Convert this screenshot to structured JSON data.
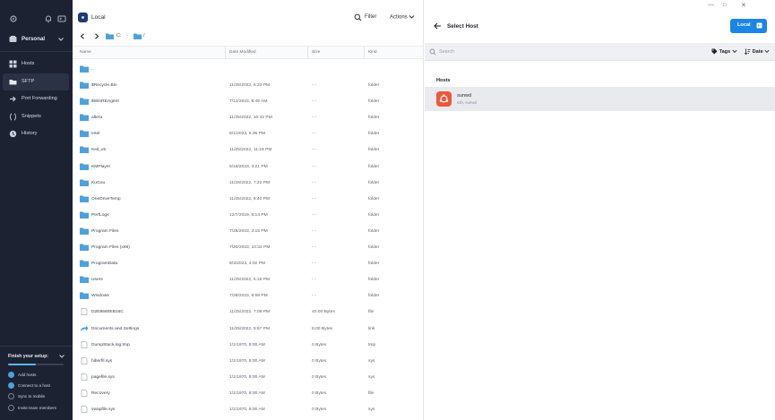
{
  "sidebar": {
    "vault_label": "Personal",
    "nav": [
      {
        "label": "Hosts",
        "icon": "grid-icon",
        "active": false
      },
      {
        "label": "SFTP",
        "icon": "folder-icon",
        "active": true
      },
      {
        "label": "Port Forwarding",
        "icon": "arrow-forward-icon",
        "active": false
      },
      {
        "label": "Snippets",
        "icon": "braces-icon",
        "active": false
      },
      {
        "label": "History",
        "icon": "clock-icon",
        "active": false
      }
    ],
    "setup": {
      "title": "Finish your setup:",
      "progress": 0.5,
      "steps": [
        {
          "label": "Add hosts",
          "done": true
        },
        {
          "label": "Connect to a host",
          "done": true
        },
        {
          "label": "Sync to mobile",
          "done": false
        },
        {
          "label": "Invite team members",
          "done": false
        }
      ]
    }
  },
  "local": {
    "title": "Local",
    "filter_label": "Filter",
    "actions_label": "Actions",
    "path": {
      "drive": "C:",
      "sep": "/"
    },
    "columns": {
      "name": "Name",
      "date": "Date Modified",
      "size": "Size",
      "kind": "Kind"
    },
    "files": [
      {
        "name": "..",
        "date": "",
        "size": "",
        "kind": "",
        "type": "folder"
      },
      {
        "name": "$Recycle.Bin",
        "date": "11/25/2022, 6:33 PM",
        "size": "- -",
        "kind": "folder",
        "type": "folder"
      },
      {
        "name": "$WinREAgent",
        "date": "7/12/2023, 6:49 AM",
        "size": "- -",
        "kind": "folder",
        "type": "folder"
      },
      {
        "name": "altera",
        "date": "11/25/2022, 10:42 PM",
        "size": "- -",
        "kind": "folder",
        "type": "folder"
      },
      {
        "name": "Intel",
        "date": "8/1/2023, 5:36 PM",
        "size": "- -",
        "kind": "folder",
        "type": "folder"
      },
      {
        "name": "Keil_v5",
        "date": "11/25/2022, 11:19 PM",
        "size": "- -",
        "kind": "folder",
        "type": "folder"
      },
      {
        "name": "KMPlayer",
        "date": "5/18/2023, 3:21 PM",
        "size": "- -",
        "kind": "folder",
        "type": "folder"
      },
      {
        "name": "KuGou",
        "date": "11/26/2022, 7:22 PM",
        "size": "- -",
        "kind": "folder",
        "type": "folder"
      },
      {
        "name": "OneDriveTemp",
        "date": "11/25/2022, 9:40 PM",
        "size": "- -",
        "kind": "folder",
        "type": "folder"
      },
      {
        "name": "PerfLogs",
        "date": "12/7/2019, 5:14 PM",
        "size": "- -",
        "kind": "folder",
        "type": "folder"
      },
      {
        "name": "Program Files",
        "date": "7/28/2023, 2:15 PM",
        "size": "- -",
        "kind": "folder",
        "type": "folder"
      },
      {
        "name": "Program Files (x86)",
        "date": "7/20/2023, 10:32 PM",
        "size": "- -",
        "kind": "folder",
        "type": "folder"
      },
      {
        "name": "ProgramData",
        "date": "8/3/2023, 4:02 PM",
        "size": "- -",
        "kind": "folder",
        "type": "folder"
      },
      {
        "name": "Users",
        "date": "11/25/2022, 6:16 PM",
        "size": "- -",
        "kind": "folder",
        "type": "folder"
      },
      {
        "name": "Windows",
        "date": "7/28/2023, 9:59 PM",
        "size": "- -",
        "kind": "folder",
        "type": "folder"
      },
      {
        "name": "D2E8660EB16C",
        "date": "11/25/2022, 7:08 PM",
        "size": "40.00 Bytes",
        "kind": "file",
        "type": "file"
      },
      {
        "name": "Documents and Settings",
        "date": "11/25/2022, 5:57 PM",
        "size": "8.00 Bytes",
        "kind": "link",
        "type": "link"
      },
      {
        "name": "DumpStack.log.tmp",
        "date": "1/1/1970, 8:00 AM",
        "size": "0 Bytes",
        "kind": "tmp",
        "type": "file"
      },
      {
        "name": "hiberfil.sys",
        "date": "1/1/1970, 8:00 AM",
        "size": "0 Bytes",
        "kind": "sys",
        "type": "file"
      },
      {
        "name": "pagefile.sys",
        "date": "1/1/1970, 8:00 AM",
        "size": "0 Bytes",
        "kind": "sys",
        "type": "file"
      },
      {
        "name": "Recovery",
        "date": "1/1/1970, 8:00 AM",
        "size": "0 Bytes",
        "kind": "file",
        "type": "file"
      },
      {
        "name": "swapfile.sys",
        "date": "1/1/1970, 8:00 AM",
        "size": "0 Bytes",
        "kind": "sys",
        "type": "file"
      }
    ]
  },
  "remote": {
    "title": "Select Host",
    "local_button": "Local",
    "search_placeholder": "Search",
    "tags_label": "Tags",
    "date_label": "Date",
    "hosts_heading": "Hosts",
    "hosts": [
      {
        "name": "sunwd",
        "subtitle": "ssh, sunwd",
        "icon": "ubuntu-icon",
        "color": "#f0563a"
      }
    ]
  },
  "colors": {
    "sidebar_bg": "#1d2233",
    "accent": "#1b86e6",
    "folder": "#4aa3df",
    "ubuntu": "#f0563a"
  }
}
